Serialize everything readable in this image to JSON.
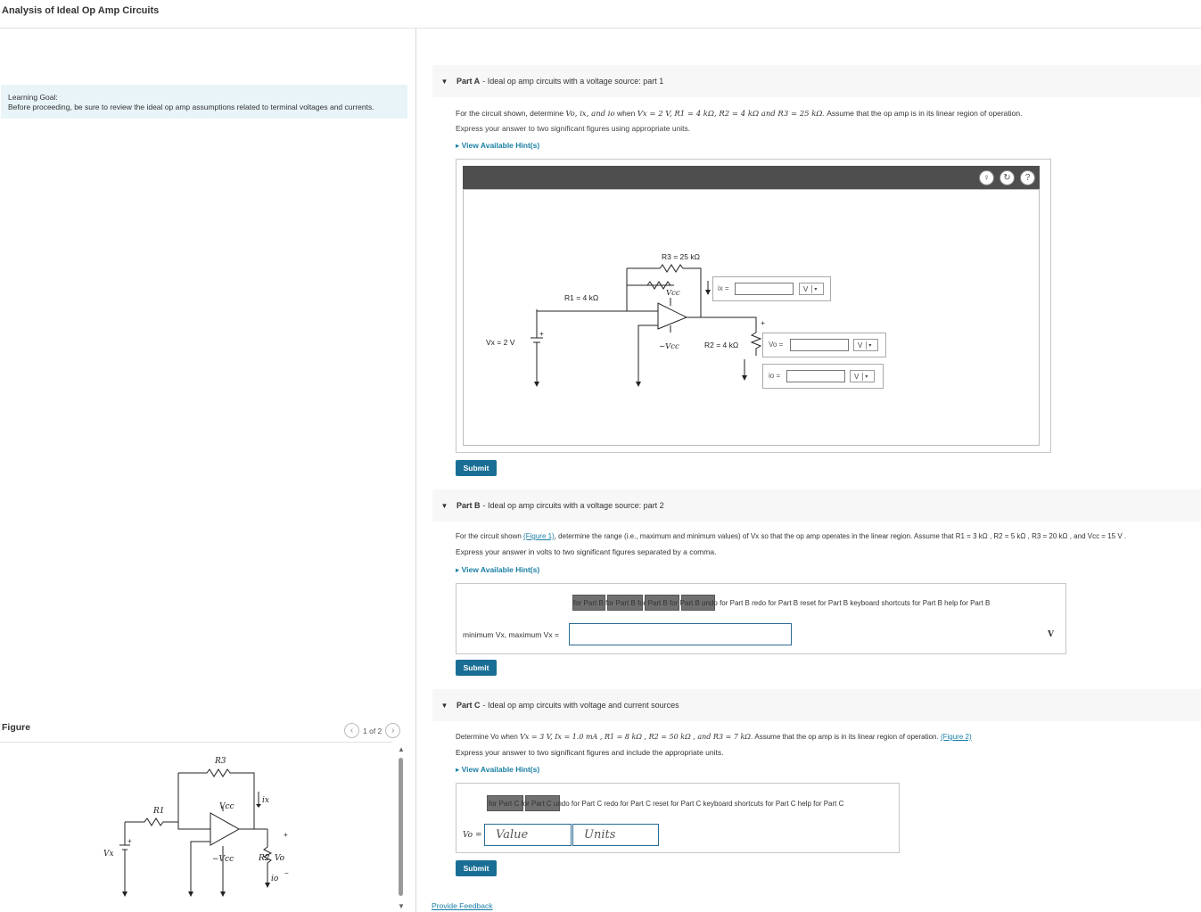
{
  "page_title": "Analysis of Ideal Op Amp Circuits",
  "learning_goal": {
    "heading": "Learning Goal:",
    "text": "Before proceeding, be sure to review the ideal op amp assumptions related to terminal voltages and currents."
  },
  "figure": {
    "label": "Figure",
    "pager_text": "1 of 2",
    "labels": {
      "r3": "R3",
      "r1": "R1",
      "vcc": "Vcc",
      "neg_vcc": "−Vcc",
      "ix": "ix",
      "r2": "R2",
      "vo": "Vo",
      "io": "io",
      "vx": "Vx"
    }
  },
  "part_a": {
    "label": "Part A",
    "title": "Ideal op amp circuits with a voltage source: part 1",
    "question_prefix": "For the circuit shown, determine",
    "question_vars": "Vo, ix, and io",
    "question_mid": "when",
    "question_values": "Vx = 2 V, R1 = 4 kΩ, R2 = 4 kΩ and R3 = 25 kΩ",
    "question_suffix": ". Assume that the op amp is in its linear region of operation.",
    "instruction": "Express your answer to two significant figures using appropriate units.",
    "hint_label": "View Available Hint(s)",
    "submit_label": "Submit",
    "diagram": {
      "r3": "R3 = 25 kΩ",
      "r1": "R1 = 4 kΩ",
      "vcc": "Vcc",
      "neg_vcc": "−Vcc",
      "vx": "Vx = 2 V",
      "r2": "R2 = 4 kΩ",
      "plus": "+",
      "ix_label": "ix =",
      "vo_label": "Vo =",
      "io_label": "io =",
      "unit": "V"
    }
  },
  "part_b": {
    "label": "Part B",
    "title": "Ideal op amp circuits with a voltage source: part 2",
    "question_prefix": "For the circuit shown",
    "figure_link": "(Figure 1)",
    "question_mid": ", determine the range (i.e., maximum and minimum values) of Vx so that the op amp operates in the linear region. Assume that R1 = 3 kΩ , R2 = 5 kΩ , R3 = 20 kΩ , and Vcc = 15 V .",
    "instruction": "Express your answer in volts to two significant figures separated by a comma.",
    "hint_label": "View Available Hint(s)",
    "toolbar_text": "for Part B  for Part B  for Part B  for Part B   undo for Part B  redo for Part B  reset for Part B  keyboard shortcuts for Part B  help for Part B",
    "answer_label": "minimum Vx, maximum Vx =",
    "unit": "V",
    "submit_label": "Submit"
  },
  "part_c": {
    "label": "Part C",
    "title": "Ideal op amp circuits with voltage and current sources",
    "question_prefix": "Determine Vo when",
    "question_values": "Vx = 3 V, Ix = 1.0 mA , R1 = 8 kΩ , R2 = 50 kΩ , and R3 = 7 kΩ",
    "question_suffix": ". Assume that the op amp is in its linear region of operation.",
    "figure_link": "(Figure 2)",
    "instruction": "Express your answer to two significant figures and include the appropriate units.",
    "hint_label": "View Available Hint(s)",
    "toolbar_text": "for Part C  for Part C   undo for Part C  redo for Part C  reset for Part C  keyboard shortcuts for Part C  help for Part C",
    "answer_label": "Vo =",
    "value_placeholder": "Value",
    "units_placeholder": "Units",
    "submit_label": "Submit"
  },
  "feedback_link": "Provide Feedback"
}
